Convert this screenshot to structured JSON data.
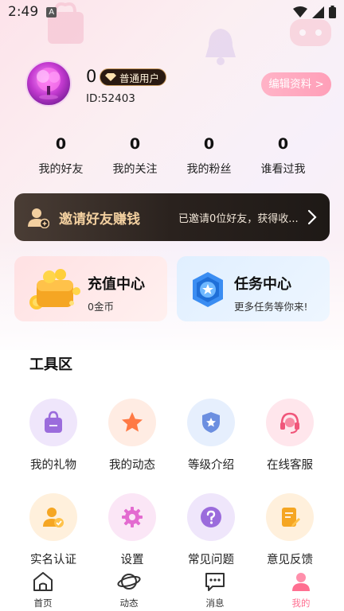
{
  "status_bar": {
    "time": "2:49",
    "notification_letter": "A"
  },
  "profile": {
    "nickname": "0",
    "level_badge": "普通用户",
    "user_id": "ID:52403",
    "edit_button": "编辑资料 >"
  },
  "stats": [
    {
      "value": "0",
      "label": "我的好友"
    },
    {
      "value": "0",
      "label": "我的关注"
    },
    {
      "value": "0",
      "label": "我的粉丝"
    },
    {
      "value": "0",
      "label": "谁看过我"
    }
  ],
  "invite": {
    "title": "邀请好友赚钱",
    "subtitle": "已邀请0位好友，获得收..."
  },
  "cards": {
    "recharge": {
      "title": "充值中心",
      "subtitle": "0金币"
    },
    "task": {
      "title": "任务中心",
      "subtitle": "更多任务等你来!"
    }
  },
  "tools": {
    "title": "工具区",
    "items": [
      {
        "label": "我的礼物",
        "icon": "gift-bag-icon"
      },
      {
        "label": "我的动态",
        "icon": "star-icon"
      },
      {
        "label": "等级介绍",
        "icon": "level-shield-icon"
      },
      {
        "label": "在线客服",
        "icon": "headset-icon"
      },
      {
        "label": "实名认证",
        "icon": "verified-user-icon"
      },
      {
        "label": "设置",
        "icon": "gear-icon"
      },
      {
        "label": "常见问题",
        "icon": "question-icon"
      },
      {
        "label": "意见反馈",
        "icon": "feedback-note-icon"
      }
    ]
  },
  "tabbar": [
    {
      "label": "首页",
      "icon": "home-icon"
    },
    {
      "label": "动态",
      "icon": "planet-icon"
    },
    {
      "label": "消息",
      "icon": "message-icon"
    },
    {
      "label": "我的",
      "icon": "person-icon"
    }
  ],
  "colors": {
    "accent": "#ff6f91",
    "invite_bg": "#2a221e",
    "invite_title": "#f3d0a0"
  }
}
